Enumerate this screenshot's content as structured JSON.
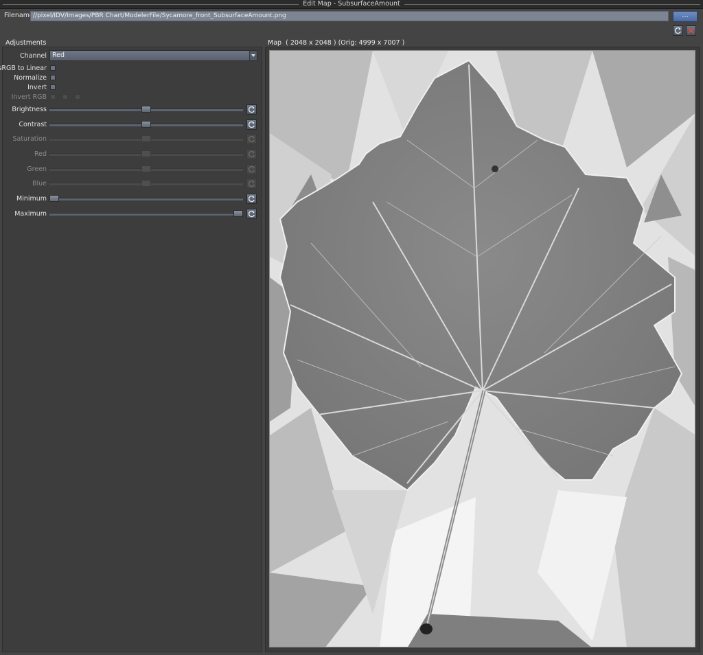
{
  "window": {
    "title": "Edit Map - SubsurfaceAmount"
  },
  "filename": {
    "label": "Filename",
    "value": "//pixel/IDV/Images/PBR Chart/ModelerFile/Sycamore_front_SubsurfaceAmount.png",
    "browse_label": "..."
  },
  "adjustments": {
    "title": "Adjustments",
    "channel": {
      "label": "Channel",
      "value": "Red"
    },
    "checkboxes": [
      {
        "label": "sRGB to Linear",
        "checked": false,
        "enabled": true
      },
      {
        "label": "Normalize",
        "checked": false,
        "enabled": true
      },
      {
        "label": "Invert",
        "checked": false,
        "enabled": true
      },
      {
        "label": "Invert RGB",
        "checked": false,
        "enabled": false
      }
    ],
    "sliders": [
      {
        "label": "Brightness",
        "value": 0.5,
        "enabled": true
      },
      {
        "label": "Contrast",
        "value": 0.5,
        "enabled": true
      },
      {
        "label": "Saturation",
        "value": 0.5,
        "enabled": false
      },
      {
        "label": "Red",
        "value": 0.5,
        "enabled": false
      },
      {
        "label": "Green",
        "value": 0.5,
        "enabled": false
      },
      {
        "label": "Blue",
        "value": 0.5,
        "enabled": false
      },
      {
        "label": "Minimum",
        "value": 0.0,
        "enabled": true
      },
      {
        "label": "Maximum",
        "value": 1.0,
        "enabled": true
      }
    ]
  },
  "map": {
    "label": "Map",
    "info": "( 2048 x 2048 ) (Orig: 4999 x 7007 )"
  },
  "colors": {
    "accent": "#5677b4",
    "panel": "#3d3d3d",
    "background": "#444444"
  }
}
